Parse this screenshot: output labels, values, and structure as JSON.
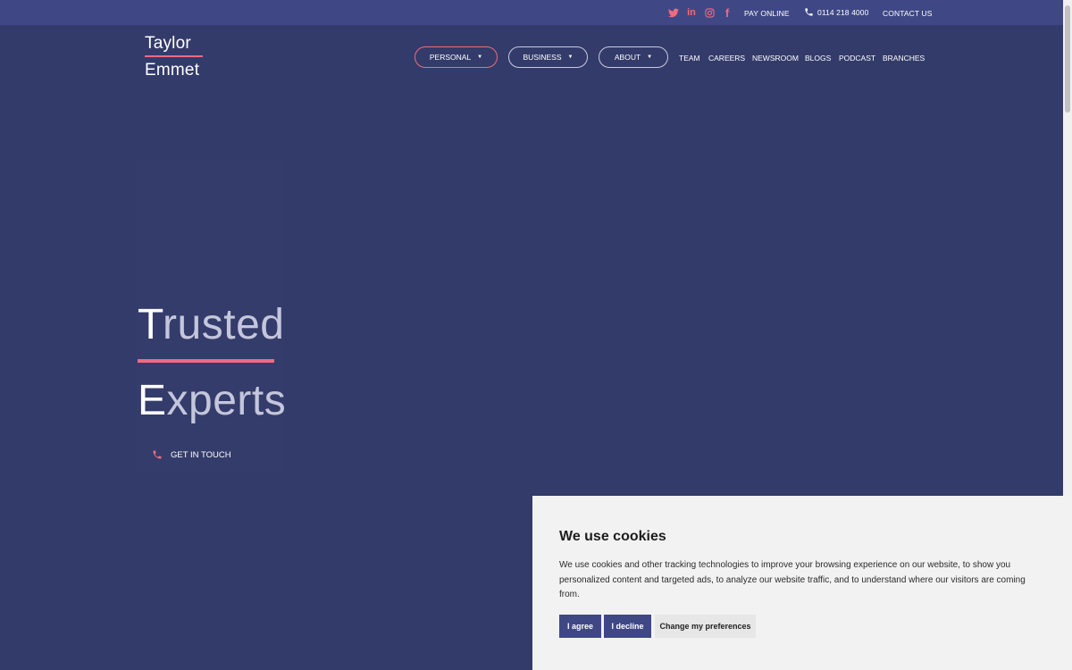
{
  "topbar": {
    "social": [
      {
        "name": "twitter-icon"
      },
      {
        "name": "linkedin-icon",
        "glyph": "in"
      },
      {
        "name": "instagram-icon"
      },
      {
        "name": "facebook-icon",
        "glyph": "f"
      }
    ],
    "pay_online": "PAY ONLINE",
    "phone": "0114 218 4000",
    "contact": "CONTACT US"
  },
  "logo": {
    "line1": "Taylor",
    "line2": "Emmet"
  },
  "nav": {
    "personal": "PERSONAL",
    "business": "BUSINESS",
    "about": "ABOUT",
    "caret": "▼",
    "team": "TEAM",
    "careers": "CAREERS",
    "newsroom": "NEWSROOM",
    "blogs": "BLOGS",
    "podcast": "PODCAST",
    "branches": "BRANCHES"
  },
  "hero": {
    "word1_first": "T",
    "word1_rest": "rusted",
    "word2_first": "E",
    "word2_rest": "xperts",
    "cta": "GET IN TOUCH"
  },
  "cookie": {
    "title": "We use cookies",
    "body": "We use cookies and other tracking technologies to improve your browsing experience on our website, to show you personalized content and targeted ads, to analyze our website traffic, and to understand where our visitors are coming from.",
    "agree": "I agree",
    "decline": "I decline",
    "preferences": "Change my preferences"
  },
  "colors": {
    "background": "#333b6a",
    "topbar": "#3f4885",
    "accent": "#f26a7e",
    "button": "#3f4885"
  }
}
